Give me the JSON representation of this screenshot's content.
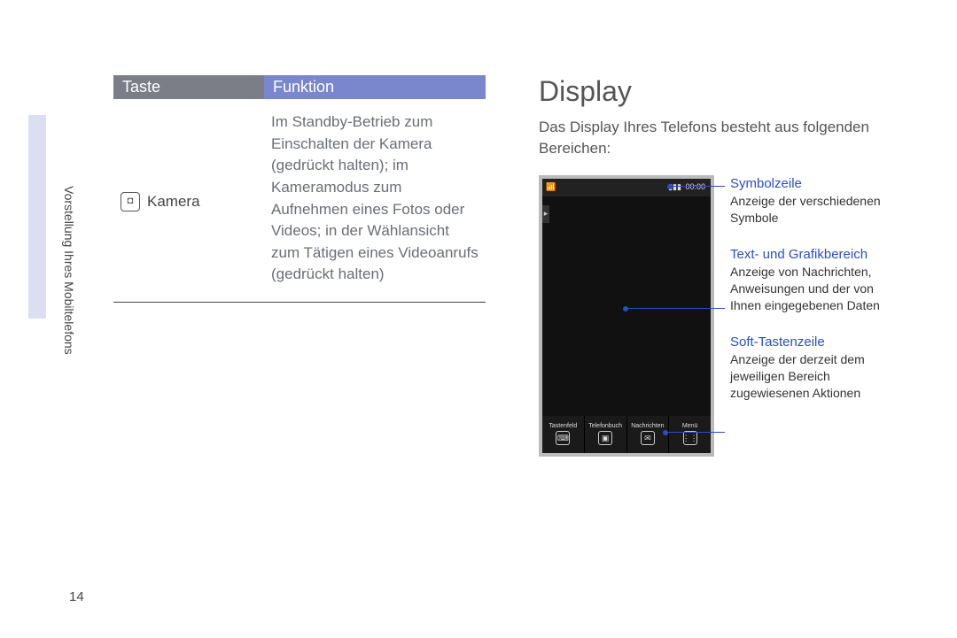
{
  "side_label": "Vorstellung Ihres Mobiltelefons",
  "page_number": "14",
  "table": {
    "header_key": "Taste",
    "header_func": "Funktion",
    "rows": [
      {
        "icon_name": "camera-key-icon",
        "icon_glyph": "◘",
        "key": "Kamera",
        "func": "Im Standby-Betrieb zum Einschalten der Kamera (gedrückt halten); im Kameramodus zum Aufnehmen eines Fotos oder Videos; in der Wählansicht zum Tätigen eines Videoanrufs (gedrückt halten)"
      }
    ]
  },
  "display": {
    "title": "Display",
    "desc": "Das Display Ihres Telefons besteht aus folgenden Bereichen:",
    "statusbar_time": "00:00",
    "softkeys": [
      {
        "label": "Tastenfeld",
        "glyph": "⌨"
      },
      {
        "label": "Telefonbuch",
        "glyph": "▣"
      },
      {
        "label": "Nachrichten",
        "glyph": "✉"
      },
      {
        "label": "Menü",
        "glyph": "⋮⋮"
      }
    ],
    "callouts": [
      {
        "title": "Symbolzeile",
        "text": "Anzeige der verschiedenen Symbole"
      },
      {
        "title": "Text- und Grafikbereich",
        "text": "Anzeige von Nachrichten, Anweisungen und der von Ihnen eingegebenen Daten"
      },
      {
        "title": "Soft-Tastenzeile",
        "text": "Anzeige der derzeit dem jeweiligen Bereich zugewiesenen Aktionen"
      }
    ]
  }
}
